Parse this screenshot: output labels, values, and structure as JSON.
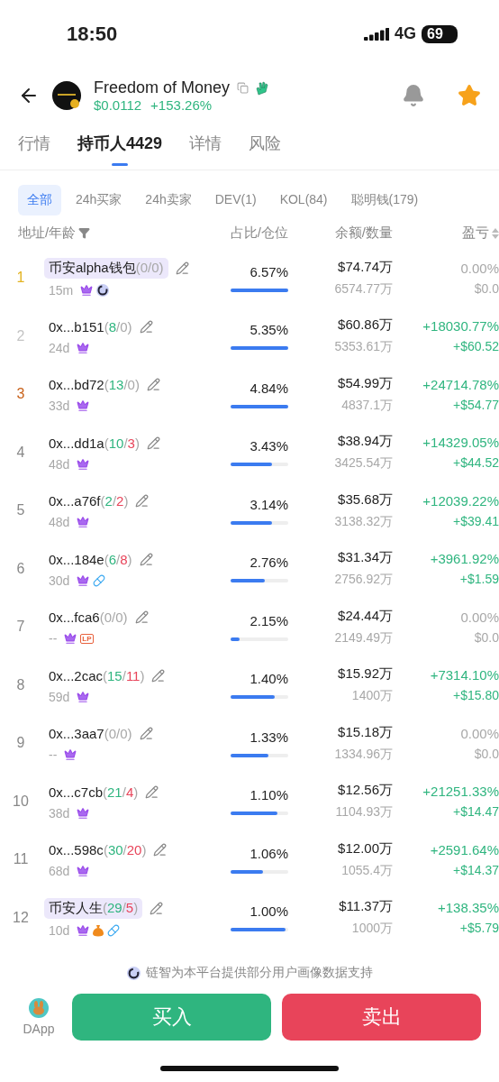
{
  "status_bar": {
    "time": "18:50",
    "network": "4G",
    "battery": "69"
  },
  "token": {
    "name": "Freedom of Money",
    "price": "$0.0112",
    "change": "+153.26%",
    "favorite": true
  },
  "tabs": [
    {
      "label": "行情",
      "selected": false
    },
    {
      "label": "持币人4429",
      "selected": true
    },
    {
      "label": "详情",
      "selected": false
    },
    {
      "label": "风险",
      "selected": false
    }
  ],
  "filters": [
    {
      "label": "全部",
      "selected": true
    },
    {
      "label": "24h买家",
      "selected": false
    },
    {
      "label": "24h卖家",
      "selected": false
    },
    {
      "label": "DEV(1)",
      "selected": false
    },
    {
      "label": "KOL(84)",
      "selected": false
    },
    {
      "label": "聪明钱(179)",
      "selected": false
    }
  ],
  "columns": [
    "地址/年龄",
    "占比/仓位",
    "余额/数量",
    "盈亏"
  ],
  "rows": [
    {
      "rank": "1",
      "color": "#e3b321",
      "tagged": true,
      "parts": [
        {
          "text": "币安alpha钱包",
          "kind": "name"
        },
        {
          "text": "(0/0)",
          "kind": "muted"
        }
      ],
      "age": "15m",
      "badges": [
        {
          "kind": "crown"
        },
        {
          "kind": "ai"
        }
      ],
      "share": "6.57%",
      "level": 1,
      "balance": "$74.74万",
      "amount": "6574.77万",
      "pnl_pct": "0.00%",
      "pnl_usd": "$0.0",
      "gain": false
    },
    {
      "rank": "2",
      "color": "#c4c4c4",
      "tagged": false,
      "parts": [
        {
          "text": "0x...b151",
          "kind": "name"
        },
        {
          "text": "(",
          "kind": "muted"
        },
        {
          "text": "8",
          "kind": "buy"
        },
        {
          "text": "/0)",
          "kind": "muted"
        }
      ],
      "age": "24d",
      "badges": [
        {
          "kind": "crown"
        }
      ],
      "share": "5.35%",
      "level": 1,
      "balance": "$60.86万",
      "amount": "5353.61万",
      "pnl_pct": "+18030.77%",
      "pnl_usd": "+$60.52",
      "gain": true
    },
    {
      "rank": "3",
      "color": "#c9631c",
      "tagged": false,
      "parts": [
        {
          "text": "0x...bd72",
          "kind": "name"
        },
        {
          "text": "(",
          "kind": "muted"
        },
        {
          "text": "13",
          "kind": "buy"
        },
        {
          "text": "/0)",
          "kind": "muted"
        }
      ],
      "age": "33d",
      "badges": [
        {
          "kind": "crown"
        }
      ],
      "share": "4.84%",
      "level": 1,
      "balance": "$54.99万",
      "amount": "4837.1万",
      "pnl_pct": "+24714.78%",
      "pnl_usd": "+$54.77",
      "gain": true
    },
    {
      "rank": "4",
      "color": "#888888",
      "tagged": false,
      "parts": [
        {
          "text": "0x...dd1a",
          "kind": "name"
        },
        {
          "text": "(",
          "kind": "muted"
        },
        {
          "text": "10",
          "kind": "buy"
        },
        {
          "text": "/",
          "kind": "muted"
        },
        {
          "text": "3",
          "kind": "sell"
        },
        {
          "text": ")",
          "kind": "muted"
        }
      ],
      "age": "48d",
      "badges": [
        {
          "kind": "crown"
        }
      ],
      "share": "3.43%",
      "level": 0.72,
      "balance": "$38.94万",
      "amount": "3425.54万",
      "pnl_pct": "+14329.05%",
      "pnl_usd": "+$44.52",
      "gain": true
    },
    {
      "rank": "5",
      "color": "#888888",
      "tagged": false,
      "parts": [
        {
          "text": "0x...a76f",
          "kind": "name"
        },
        {
          "text": "(",
          "kind": "muted"
        },
        {
          "text": "2",
          "kind": "buy"
        },
        {
          "text": "/",
          "kind": "muted"
        },
        {
          "text": "2",
          "kind": "sell"
        },
        {
          "text": ")",
          "kind": "muted"
        }
      ],
      "age": "48d",
      "badges": [
        {
          "kind": "crown"
        }
      ],
      "share": "3.14%",
      "level": 0.72,
      "balance": "$35.68万",
      "amount": "3138.32万",
      "pnl_pct": "+12039.22%",
      "pnl_usd": "+$39.41",
      "gain": true
    },
    {
      "rank": "6",
      "color": "#888888",
      "tagged": false,
      "parts": [
        {
          "text": "0x...184e",
          "kind": "name"
        },
        {
          "text": "(",
          "kind": "muted"
        },
        {
          "text": "6",
          "kind": "buy"
        },
        {
          "text": "/",
          "kind": "muted"
        },
        {
          "text": "8",
          "kind": "sell"
        },
        {
          "text": ")",
          "kind": "muted"
        }
      ],
      "age": "30d",
      "badges": [
        {
          "kind": "crown"
        },
        {
          "kind": "pill"
        }
      ],
      "share": "2.76%",
      "level": 0.6,
      "balance": "$31.34万",
      "amount": "2756.92万",
      "pnl_pct": "+3961.92%",
      "pnl_usd": "+$1.59",
      "gain": true
    },
    {
      "rank": "7",
      "color": "#888888",
      "tagged": false,
      "parts": [
        {
          "text": "0x...fca6",
          "kind": "name"
        },
        {
          "text": "(0/0)",
          "kind": "muted"
        }
      ],
      "age": "--",
      "badges": [
        {
          "kind": "crown"
        },
        {
          "kind": "lp",
          "label": "LP"
        }
      ],
      "share": "2.15%",
      "level": 0.15,
      "balance": "$24.44万",
      "amount": "2149.49万",
      "pnl_pct": "0.00%",
      "pnl_usd": "$0.0",
      "gain": false
    },
    {
      "rank": "8",
      "color": "#888888",
      "tagged": false,
      "parts": [
        {
          "text": "0x...2cac",
          "kind": "name"
        },
        {
          "text": "(",
          "kind": "muted"
        },
        {
          "text": "15",
          "kind": "buy"
        },
        {
          "text": "/",
          "kind": "muted"
        },
        {
          "text": "11",
          "kind": "sell"
        },
        {
          "text": ")",
          "kind": "muted"
        }
      ],
      "age": "59d",
      "badges": [
        {
          "kind": "crown"
        }
      ],
      "share": "1.40%",
      "level": 0.76,
      "balance": "$15.92万",
      "amount": "1400万",
      "pnl_pct": "+7314.10%",
      "pnl_usd": "+$15.80",
      "gain": true
    },
    {
      "rank": "9",
      "color": "#888888",
      "tagged": false,
      "parts": [
        {
          "text": "0x...3aa7",
          "kind": "name"
        },
        {
          "text": "(0/0)",
          "kind": "muted"
        }
      ],
      "age": "--",
      "badges": [
        {
          "kind": "crown"
        }
      ],
      "share": "1.33%",
      "level": 0.66,
      "balance": "$15.18万",
      "amount": "1334.96万",
      "pnl_pct": "0.00%",
      "pnl_usd": "$0.0",
      "gain": false
    },
    {
      "rank": "10",
      "color": "#888888",
      "tagged": false,
      "parts": [
        {
          "text": "0x...c7cb",
          "kind": "name"
        },
        {
          "text": "(",
          "kind": "muted"
        },
        {
          "text": "21",
          "kind": "buy"
        },
        {
          "text": "/",
          "kind": "muted"
        },
        {
          "text": "4",
          "kind": "sell"
        },
        {
          "text": ")",
          "kind": "muted"
        }
      ],
      "age": "38d",
      "badges": [
        {
          "kind": "crown"
        }
      ],
      "share": "1.10%",
      "level": 0.82,
      "balance": "$12.56万",
      "amount": "1104.93万",
      "pnl_pct": "+21251.33%",
      "pnl_usd": "+$14.47",
      "gain": true
    },
    {
      "rank": "11",
      "color": "#888888",
      "tagged": false,
      "parts": [
        {
          "text": "0x...598c",
          "kind": "name"
        },
        {
          "text": "(",
          "kind": "muted"
        },
        {
          "text": "30",
          "kind": "buy"
        },
        {
          "text": "/",
          "kind": "muted"
        },
        {
          "text": "20",
          "kind": "sell"
        },
        {
          "text": ")",
          "kind": "muted"
        }
      ],
      "age": "68d",
      "badges": [
        {
          "kind": "crown"
        }
      ],
      "share": "1.06%",
      "level": 0.56,
      "balance": "$12.00万",
      "amount": "1055.4万",
      "pnl_pct": "+2591.64%",
      "pnl_usd": "+$14.37",
      "gain": true
    },
    {
      "rank": "12",
      "color": "#888888",
      "tagged": true,
      "parts": [
        {
          "text": "币安人生",
          "kind": "name"
        },
        {
          "text": "(",
          "kind": "muted"
        },
        {
          "text": "29",
          "kind": "buy"
        },
        {
          "text": "/",
          "kind": "muted"
        },
        {
          "text": "5",
          "kind": "sell"
        },
        {
          "text": ")",
          "kind": "muted"
        }
      ],
      "age": "10d",
      "badges": [
        {
          "kind": "crown"
        },
        {
          "kind": "money"
        },
        {
          "kind": "pill"
        }
      ],
      "share": "1.00%",
      "level": 0.95,
      "balance": "$11.37万",
      "amount": "1000万",
      "pnl_pct": "+138.35%",
      "pnl_usd": "+$5.79",
      "gain": true
    }
  ],
  "note": "链智为本平台提供部分用户画像数据支持",
  "footer": {
    "dapp": "DApp",
    "buy": "买入",
    "sell": "卖出"
  }
}
